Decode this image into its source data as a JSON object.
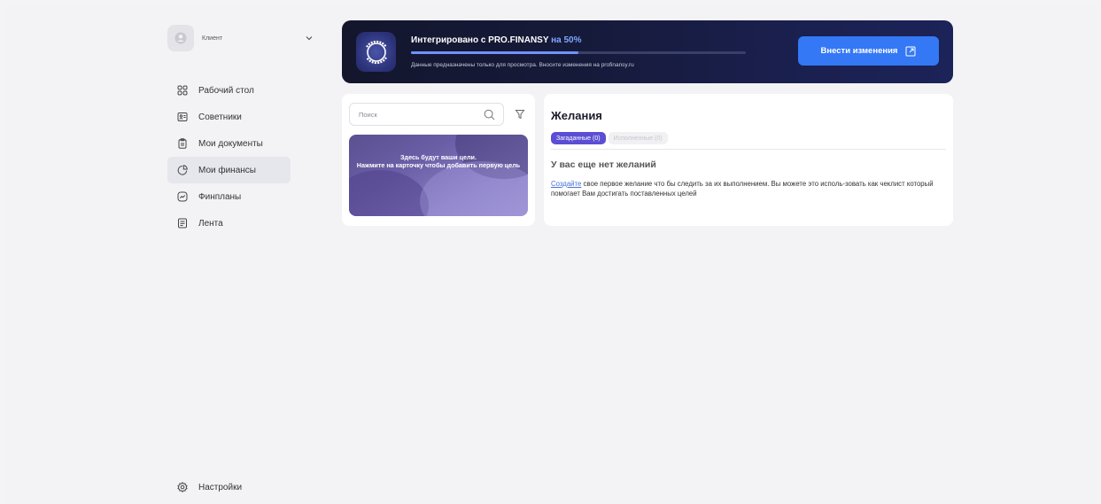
{
  "colors": {
    "accent": "#3478f6",
    "tab_active": "#5b4ed4",
    "banner_bg": "#161a3a",
    "progress_fill": "#6f93ff",
    "highlight": "#7ea7ff"
  },
  "user": {
    "role_label": "Клиент",
    "avatar_icon": "user-icon",
    "dropdown_icon": "chevron-down-icon"
  },
  "sidebar": {
    "items": [
      {
        "label": "Рабочий стол",
        "icon": "dashboard-icon",
        "active": false
      },
      {
        "label": "Советники",
        "icon": "id-card-icon",
        "active": false
      },
      {
        "label": "Мои документы",
        "icon": "clipboard-icon",
        "active": false
      },
      {
        "label": "Мои финансы",
        "icon": "pie-chart-icon",
        "active": true
      },
      {
        "label": "Финпланы",
        "icon": "chart-line-icon",
        "active": false
      },
      {
        "label": "Лента",
        "icon": "news-feed-icon",
        "active": false
      }
    ],
    "settings_label": "Настройки"
  },
  "banner": {
    "title": "Интегрировано с PRO.FINANSY",
    "percent_prefix": "на",
    "percent_text": "50%",
    "progress": 0.5,
    "note": "Данные предназначены только для просмотра. Вносите изменения на profinansy.ru",
    "button_label": "Внести изменения",
    "button_icon": "external-link-icon",
    "logo_icon": "profinansy-logo-icon"
  },
  "goals": {
    "search_placeholder": "Поиск",
    "search_icon": "search-icon",
    "filter_icon": "filter-icon",
    "card_text": "Здесь будут ваши цели.\nНажмите на карточку чтобы добавить первую цель"
  },
  "wishes": {
    "title": "Желания",
    "tabs": [
      {
        "label": "Загаданные (0)",
        "active": true
      },
      {
        "label": "Исполненные (0)",
        "active": false
      }
    ],
    "empty_title": "У вас еще нет желаний",
    "empty_link": "Создайте",
    "empty_desc": " свое первое желание что бы следить за их выполнением. Вы можете это исполь-зовать как чеклист который помогает Вам достигать поставленных целей"
  }
}
